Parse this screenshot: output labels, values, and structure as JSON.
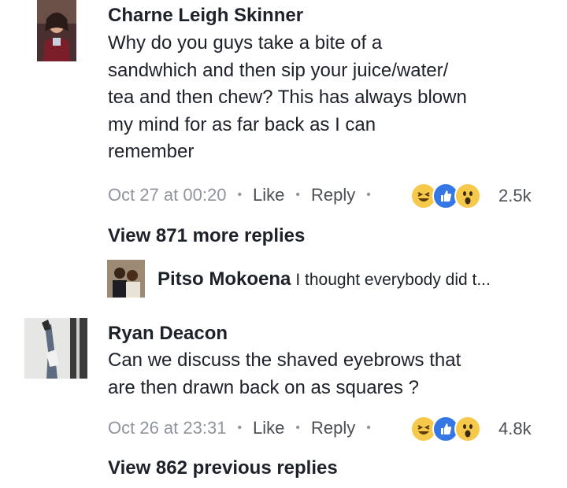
{
  "comments": [
    {
      "author": "Charne Leigh Skinner",
      "text_lines": [
        "Why do you guys take a bite of a",
        "sandwhich and then sip your juice/water/",
        "tea and then chew? This has always blown",
        "my mind for as far back as I can",
        "remember"
      ],
      "timestamp": "Oct 27 at 00:20",
      "like_label": "Like",
      "reply_label": "Reply",
      "reaction_count": "2.5k",
      "reactions": [
        "haha-icon",
        "like-icon",
        "wow-icon"
      ],
      "view_replies_label": "View 871 more replies",
      "reply_preview": {
        "author": "Pitso Mokoena",
        "text": "I thought everybody did t..."
      }
    },
    {
      "author": "Ryan Deacon",
      "text_lines": [
        "Can we discuss the shaved eyebrows that",
        "are then drawn back on as squares ?"
      ],
      "timestamp": "Oct 26 at 23:31",
      "like_label": "Like",
      "reply_label": "Reply",
      "reaction_count": "4.8k",
      "reactions": [
        "haha-icon",
        "like-icon",
        "wow-icon"
      ],
      "view_replies_label": "View 862 previous replies"
    }
  ],
  "colors": {
    "text": "#1d2129",
    "meta": "#90949c",
    "link": "#4b4f56",
    "like_blue": "#3578e5",
    "emoji_yellow": "#f7c94a"
  }
}
